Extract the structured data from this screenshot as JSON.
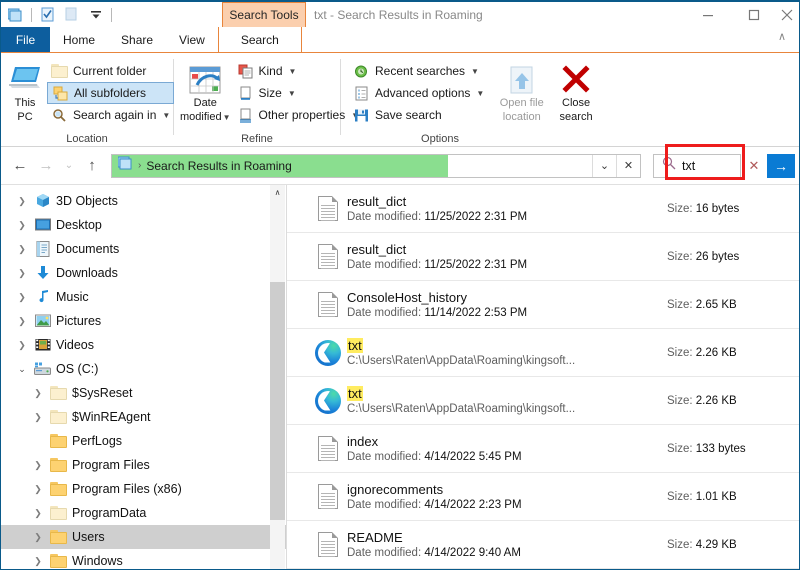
{
  "window": {
    "title": "txt - Search Results in Roaming",
    "quick_access": [
      "explorer-icon",
      "properties-icon",
      "new-folder-icon",
      "customize-dropdown"
    ],
    "contextual_tab_header": "Search Tools",
    "controls": {
      "minimize": "—",
      "maximize": "□",
      "close": "✕"
    },
    "ribbon_collapse": "∧"
  },
  "tabs": [
    {
      "label": "File",
      "id": "file"
    },
    {
      "label": "Home",
      "id": "home"
    },
    {
      "label": "Share",
      "id": "share"
    },
    {
      "label": "View",
      "id": "view"
    },
    {
      "label": "Search",
      "id": "search"
    }
  ],
  "ribbon": {
    "groups": [
      {
        "label": "Location",
        "big_button": {
          "label_line1": "This",
          "label_line2": "PC",
          "icon": "this-pc-icon"
        },
        "items": [
          {
            "label": "Current folder",
            "icon": "folder-icon",
            "selected": false,
            "caret": false
          },
          {
            "label": "All subfolders",
            "icon": "subfolders-icon",
            "selected": true,
            "caret": false
          },
          {
            "label": "Search again in",
            "icon": "search-again-icon",
            "selected": false,
            "caret": true
          }
        ]
      },
      {
        "label": "Refine",
        "big_button": {
          "label_line1": "Date",
          "label_line2": "modified",
          "icon": "calendar-icon",
          "caret": true
        },
        "items": [
          {
            "label": "Kind",
            "icon": "kind-icon",
            "caret": true
          },
          {
            "label": "Size",
            "icon": "size-icon",
            "caret": true
          },
          {
            "label": "Other properties",
            "icon": "other-properties-icon",
            "caret": true
          }
        ]
      },
      {
        "label": "Options",
        "items": [
          {
            "label": "Recent searches",
            "icon": "recent-searches-icon",
            "caret": true
          },
          {
            "label": "Advanced options",
            "icon": "advanced-options-icon",
            "caret": true
          },
          {
            "label": "Save search",
            "icon": "save-search-icon",
            "caret": false
          }
        ],
        "big_buttons": [
          {
            "label_line1": "Open file",
            "label_line2": "location",
            "icon": "open-file-location-icon",
            "disabled": true
          },
          {
            "label_line1": "Close",
            "label_line2": "search",
            "icon": "close-search-icon",
            "disabled": false
          }
        ]
      }
    ]
  },
  "navbar": {
    "back": "←",
    "forward": "→",
    "recent": "⌄",
    "up": "↑",
    "breadcrumb": "Search Results in Roaming",
    "breadcrumb_separator": "›",
    "dropdown": "⌄",
    "stop": "✕",
    "progress_percent": 63
  },
  "search": {
    "value": "txt",
    "icon": "search-icon",
    "clear": "✕",
    "go": "→",
    "highlighted": true,
    "highlight_color": "#ee1c1c"
  },
  "nav_pane": {
    "items": [
      {
        "label": "3D Objects",
        "icon": "3d-objects-icon",
        "depth": 1,
        "expander": "closed",
        "selected": false
      },
      {
        "label": "Desktop",
        "icon": "desktop-icon",
        "depth": 1,
        "expander": "closed",
        "selected": false
      },
      {
        "label": "Documents",
        "icon": "documents-icon",
        "depth": 1,
        "expander": "closed",
        "selected": false
      },
      {
        "label": "Downloads",
        "icon": "downloads-icon",
        "depth": 1,
        "expander": "closed",
        "selected": false
      },
      {
        "label": "Music",
        "icon": "music-icon",
        "depth": 1,
        "expander": "closed",
        "selected": false
      },
      {
        "label": "Pictures",
        "icon": "pictures-icon",
        "depth": 1,
        "expander": "closed",
        "selected": false
      },
      {
        "label": "Videos",
        "icon": "videos-icon",
        "depth": 1,
        "expander": "closed",
        "selected": false
      },
      {
        "label": "OS (C:)",
        "icon": "drive-icon",
        "depth": 1,
        "expander": "open",
        "selected": false
      },
      {
        "label": "$SysReset",
        "icon": "folder-pale-icon",
        "depth": 2,
        "expander": "closed",
        "selected": false
      },
      {
        "label": "$WinREAgent",
        "icon": "folder-pale-icon",
        "depth": 2,
        "expander": "closed",
        "selected": false
      },
      {
        "label": "PerfLogs",
        "icon": "folder-icon",
        "depth": 2,
        "expander": "none",
        "selected": false
      },
      {
        "label": "Program Files",
        "icon": "folder-icon",
        "depth": 2,
        "expander": "closed",
        "selected": false
      },
      {
        "label": "Program Files (x86)",
        "icon": "folder-icon",
        "depth": 2,
        "expander": "closed",
        "selected": false
      },
      {
        "label": "ProgramData",
        "icon": "folder-pale-icon",
        "depth": 2,
        "expander": "closed",
        "selected": false
      },
      {
        "label": "Users",
        "icon": "folder-icon",
        "depth": 2,
        "expander": "closed",
        "selected": true
      },
      {
        "label": "Windows",
        "icon": "folder-icon",
        "depth": 2,
        "expander": "closed",
        "selected": false
      }
    ],
    "scroll_up_arrow": "∧"
  },
  "file_list": {
    "date_label": "Date modified:",
    "size_label": "Size:",
    "rows": [
      {
        "name": "result_dict",
        "name_highlight": "",
        "icon": "text-file-icon",
        "sub_label": "Date modified:",
        "sub_value": "11/25/2022 2:31 PM",
        "size_value": "16 bytes"
      },
      {
        "name": "result_dict",
        "name_highlight": "",
        "icon": "text-file-icon",
        "sub_label": "Date modified:",
        "sub_value": "11/25/2022 2:31 PM",
        "size_value": "26 bytes"
      },
      {
        "name": "ConsoleHost_history",
        "name_highlight": "",
        "icon": "text-file-icon",
        "sub_label": "Date modified:",
        "sub_value": "11/14/2022 2:53 PM",
        "size_value": "2.65 KB"
      },
      {
        "name": "",
        "name_highlight": "txt",
        "icon": "edge-browser-icon",
        "sub_label": "",
        "sub_value": "C:\\Users\\Raten\\AppData\\Roaming\\kingsoft...",
        "size_value": "2.26 KB"
      },
      {
        "name": "",
        "name_highlight": "txt",
        "icon": "edge-browser-icon",
        "sub_label": "",
        "sub_value": "C:\\Users\\Raten\\AppData\\Roaming\\kingsoft...",
        "size_value": "2.26 KB"
      },
      {
        "name": "index",
        "name_highlight": "",
        "icon": "text-file-icon",
        "sub_label": "Date modified:",
        "sub_value": "4/14/2022 5:45 PM",
        "size_value": "133 bytes"
      },
      {
        "name": "ignorecomments",
        "name_highlight": "",
        "icon": "text-file-icon",
        "sub_label": "Date modified:",
        "sub_value": "4/14/2022 2:23 PM",
        "size_value": "1.01 KB"
      },
      {
        "name": "README",
        "name_highlight": "",
        "icon": "text-file-icon",
        "sub_label": "Date modified:",
        "sub_value": "4/14/2022 9:40 AM",
        "size_value": "4.29 KB"
      }
    ]
  },
  "colors": {
    "file_tab_blue": "#0d5e9e",
    "contextual_tab_peach": "#fbcfae",
    "contextual_tab_orange": "#e8853c",
    "progress_green": "#8ade8f",
    "search_match_yellow": "#ffec60",
    "selection_gray": "#cfcfcf",
    "go_button_blue": "#0a7bd4"
  }
}
